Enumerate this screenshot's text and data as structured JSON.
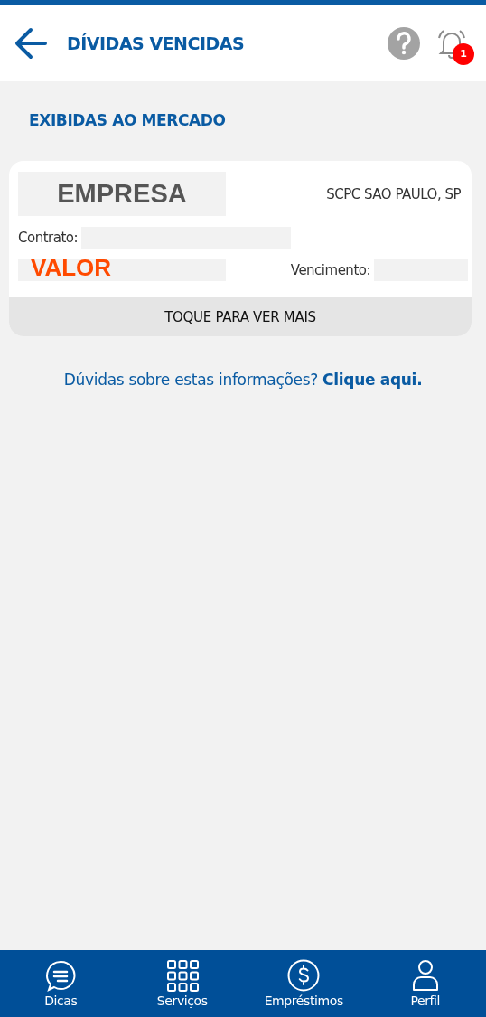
{
  "header": {
    "title": "DÍVIDAS VENCIDAS",
    "notification_count": "1"
  },
  "section_title": "EXIBIDAS AO MERCADO",
  "debt_card": {
    "company": "EMPRESA",
    "bureau": "SCPC SAO PAULO, SP",
    "contract_label": "Contrato:",
    "amount_label": "VALOR",
    "due_label": "Vencimento:",
    "footer": "TOQUE PARA VER MAIS"
  },
  "help_text": "Dúvidas sobre estas informações?",
  "help_link": "Clique aqui.",
  "bottom_nav": [
    {
      "label": "Dicas",
      "kind": "chat"
    },
    {
      "label": "Serviços",
      "kind": "grid"
    },
    {
      "label": "Empréstimos",
      "kind": "money"
    },
    {
      "label": "Perfil",
      "kind": "person"
    }
  ]
}
